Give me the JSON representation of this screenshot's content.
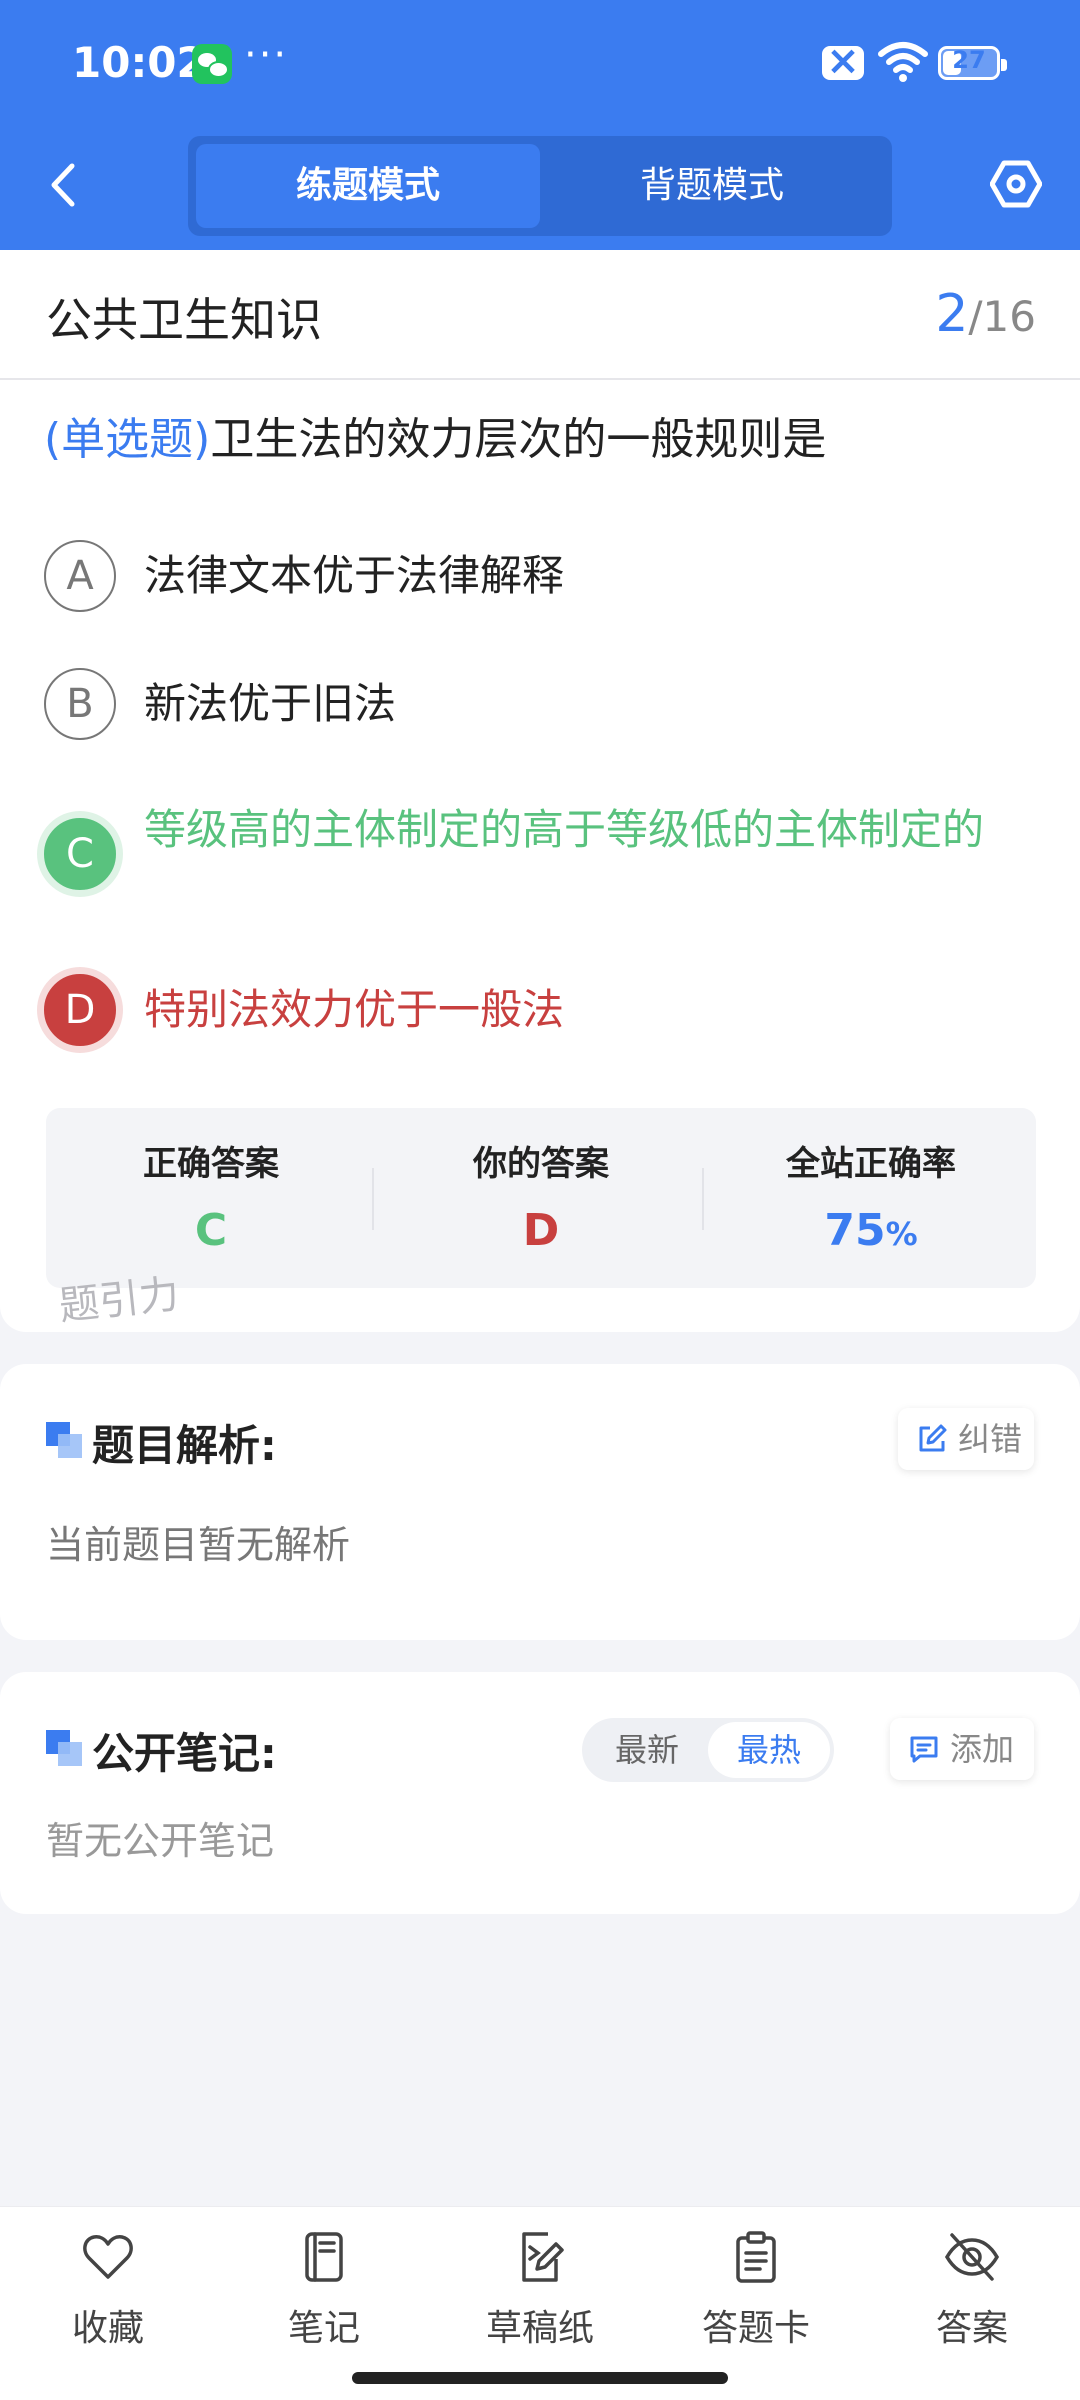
{
  "status_bar": {
    "time": "10:02",
    "more": "···",
    "battery": "27"
  },
  "header": {
    "tabs": [
      {
        "label": "练题模式"
      },
      {
        "label": "背题模式"
      }
    ]
  },
  "subject": {
    "title": "公共卫生知识",
    "current": "2",
    "total": "/16"
  },
  "question": {
    "type": "(单选题)",
    "text": "卫生法的效力层次的一般规则是",
    "options": [
      {
        "letter": "A",
        "text": "法律文本优于法律解释",
        "state": "normal"
      },
      {
        "letter": "B",
        "text": "新法优于旧法",
        "state": "normal"
      },
      {
        "letter": "C",
        "text": "等级高的主体制定的高于等级低的主体制定的",
        "state": "correct"
      },
      {
        "letter": "D",
        "text": "特别法效力优于一般法",
        "state": "wrong"
      }
    ]
  },
  "answer_summary": {
    "correct_label": "正确答案",
    "correct_value": "C",
    "yours_label": "你的答案",
    "yours_value": "D",
    "rate_label": "全站正确率",
    "rate_value": "75",
    "rate_unit": "%"
  },
  "watermark": "题引力",
  "analysis": {
    "title": "题目解析:",
    "feedback_label": "纠错",
    "body": "当前题目暂无解析"
  },
  "notes": {
    "title": "公开笔记:",
    "sort_latest": "最新",
    "sort_hot": "最热",
    "add_label": "添加",
    "body": "暂无公开笔记"
  },
  "bottom_nav": [
    {
      "label": "收藏",
      "icon": "heart-icon"
    },
    {
      "label": "笔记",
      "icon": "notebook-icon"
    },
    {
      "label": "草稿纸",
      "icon": "draft-paper-icon"
    },
    {
      "label": "答题卡",
      "icon": "answer-sheet-icon"
    },
    {
      "label": "答案",
      "icon": "eye-off-icon"
    }
  ],
  "colors": {
    "primary": "#3b7cf0",
    "correct": "#59c27e",
    "wrong": "#c8403f",
    "page_bg": "#f3f4f8",
    "header_bg": "#3b7cf0"
  }
}
